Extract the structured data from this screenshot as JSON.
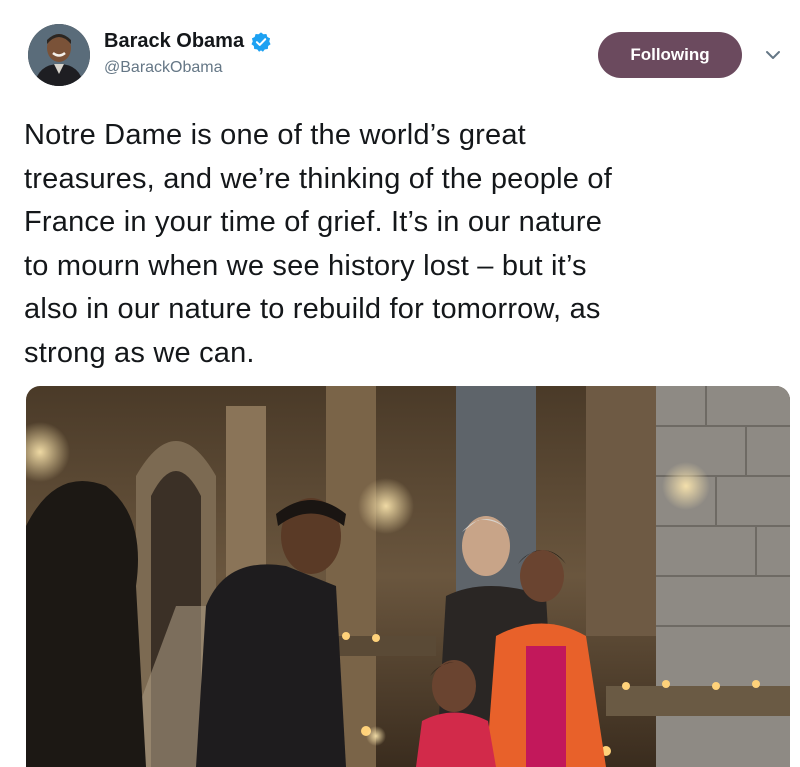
{
  "tweet": {
    "author": {
      "display_name": "Barack Obama",
      "handle": "@BarackObama",
      "verified_icon": "verified-badge-icon",
      "avatar_icon": "avatar"
    },
    "follow_button": {
      "label": "Following",
      "color": "#6b4a5e"
    },
    "menu_icon": "chevron-down-icon",
    "text_lines": [
      "Notre Dame is one of the world’s great",
      "treasures, and we’re thinking of the people of",
      "France in your time of grief. It’s in our nature",
      "to mourn when we see history lost – but it’s",
      "also in our nature to rebuild for tomorrow, as",
      "strong as we can."
    ],
    "media": {
      "type": "photo"
    }
  },
  "colors": {
    "text": "#14171a",
    "secondary": "#657786",
    "verified": "#1da1f2"
  }
}
